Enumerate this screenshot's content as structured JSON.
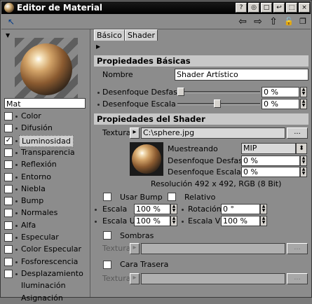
{
  "window": {
    "title": "Editor de Material"
  },
  "titlebar_buttons": [
    "?",
    "◎",
    "□",
    "↩",
    "⬚",
    "×"
  ],
  "toolbar": {
    "back": "⇦",
    "forward": "⇨",
    "up": "⇧",
    "pin": "🔓"
  },
  "left": {
    "material_name": "Mat",
    "channels": [
      {
        "label": "Color",
        "checked": false
      },
      {
        "label": "Difusión",
        "checked": false
      },
      {
        "label": "Luminosidad",
        "checked": true,
        "selected": true
      },
      {
        "label": "Transparencia",
        "checked": false
      },
      {
        "label": "Reflexión",
        "checked": false
      },
      {
        "label": "Entorno",
        "checked": false
      },
      {
        "label": "Niebla",
        "checked": false
      },
      {
        "label": "Bump",
        "checked": false
      },
      {
        "label": "Normales",
        "checked": false
      },
      {
        "label": "Alfa",
        "checked": false
      },
      {
        "label": "Especular",
        "checked": false
      },
      {
        "label": "Color Especular",
        "checked": false
      },
      {
        "label": "Fosforescencia",
        "checked": false
      },
      {
        "label": "Desplazamiento",
        "checked": false
      },
      {
        "label": "Iluminación",
        "checked": null
      },
      {
        "label": "Asignación",
        "checked": null
      }
    ]
  },
  "tabs": [
    "Básico",
    "Shader"
  ],
  "basic": {
    "section_title": "Propiedades Básicas",
    "nombre_label": "Nombre",
    "nombre_value": "Shader Artístico",
    "desfase_label": "Desenfoque Desfase",
    "desfase_value": "0 %",
    "escala_label": "Desenfoque Escala",
    "escala_value": "0 %"
  },
  "shader": {
    "section_title": "Propiedades del Shader",
    "textura_label": "Textura",
    "textura_value": "C:\\sphere.jpg",
    "browse": "...",
    "muestreando_label": "Muestreando",
    "muestreando_value": "MIP",
    "desfase_label": "Desenfoque Desfase",
    "desfase_value": "0 %",
    "escala_label": "Desenfoque Escala",
    "escala_value": "0 %",
    "resolution": "Resolución 492 x 492, RGB (8 Bit)",
    "usar_bump": "Usar Bump",
    "relativo": "Relativo",
    "escala_lbl": "Escala",
    "escala_val": "100 %",
    "rotacion_lbl": "Rotación",
    "rotacion_val": "0 °",
    "escala_u_lbl": "Escala U",
    "escala_u_val": "100 %",
    "escala_v_lbl": "Escala V",
    "escala_v_val": "100 %",
    "sombras": "Sombras",
    "textura2_label": "Textura",
    "cara_trasera": "Cara Trasera",
    "textura3_label": "Textura"
  }
}
